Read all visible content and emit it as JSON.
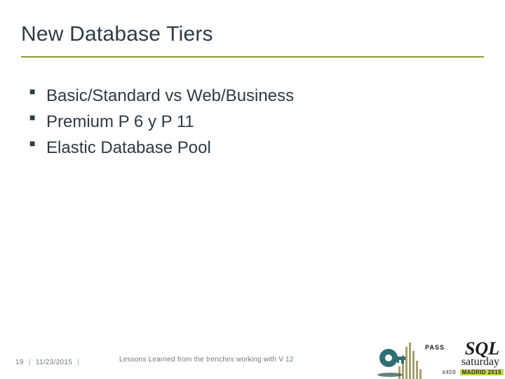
{
  "title": "New Database Tiers",
  "bullets": [
    "Basic/Standard vs Web/Business",
    "Premium P 6 y P 11",
    "Elastic Database Pool"
  ],
  "footer": {
    "page": "19",
    "date": "11/23/2015",
    "event_title": "Lessons Learned from the trenches working with V 12"
  },
  "logo": {
    "pass": "PASS",
    "sql": "SQL",
    "saturday": "saturday",
    "event_id": "#459",
    "event_city": "MADRID 2015"
  }
}
